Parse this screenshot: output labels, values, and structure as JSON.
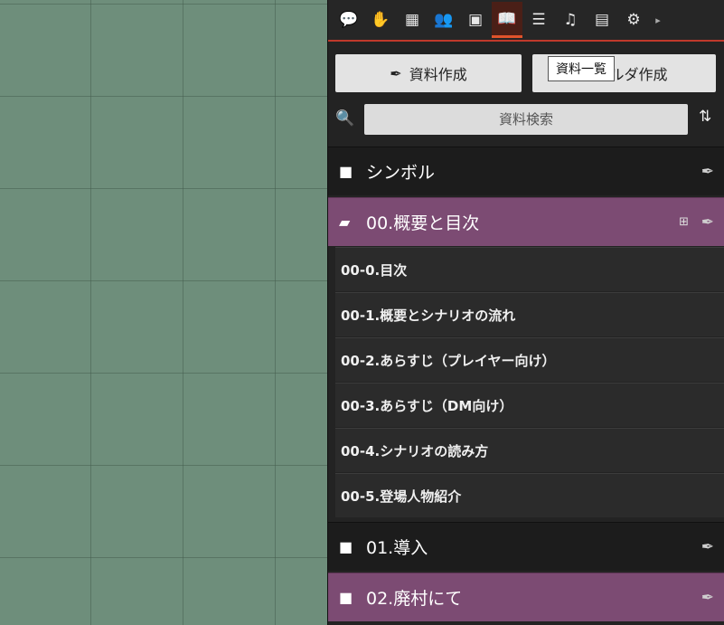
{
  "toolbar": {
    "tools": [
      {
        "icon": "chat-icon",
        "glyph": "💬"
      },
      {
        "icon": "hand-icon",
        "glyph": "✋"
      },
      {
        "icon": "map-icon",
        "glyph": "▦"
      },
      {
        "icon": "users-icon",
        "glyph": "👥"
      },
      {
        "icon": "briefcase-icon",
        "glyph": "▣"
      },
      {
        "icon": "book-icon",
        "glyph": "📖"
      },
      {
        "icon": "list-icon",
        "glyph": "☰"
      },
      {
        "icon": "music-icon",
        "glyph": "♫"
      },
      {
        "icon": "id-card-icon",
        "glyph": "▤"
      },
      {
        "icon": "settings-icon",
        "glyph": "⚙"
      },
      {
        "icon": "chevron-right-icon",
        "glyph": "▸"
      }
    ],
    "active_index": 5
  },
  "buttons": {
    "create_document": "資料作成",
    "create_folder": "フォルダ作成",
    "feather_glyph": "✒"
  },
  "tooltip": "資料一覧",
  "search": {
    "placeholder": "資料検索"
  },
  "tree": {
    "folder_symbol": "シンボル",
    "folder_00": "00.概要と目次",
    "items_00": [
      "00-0.目次",
      "00-1.概要とシナリオの流れ",
      "00-2.あらすじ（プレイヤー向け）",
      "00-3.あらすじ（DM向け）",
      "00-4.シナリオの読み方",
      "00-5.登場人物紹介"
    ],
    "folder_01": "01.導入",
    "folder_02": "02.廃村にて"
  },
  "colors": {
    "accent": "#e0532b",
    "folder_open": "#7c4b73",
    "background": "#6e8e7b"
  }
}
